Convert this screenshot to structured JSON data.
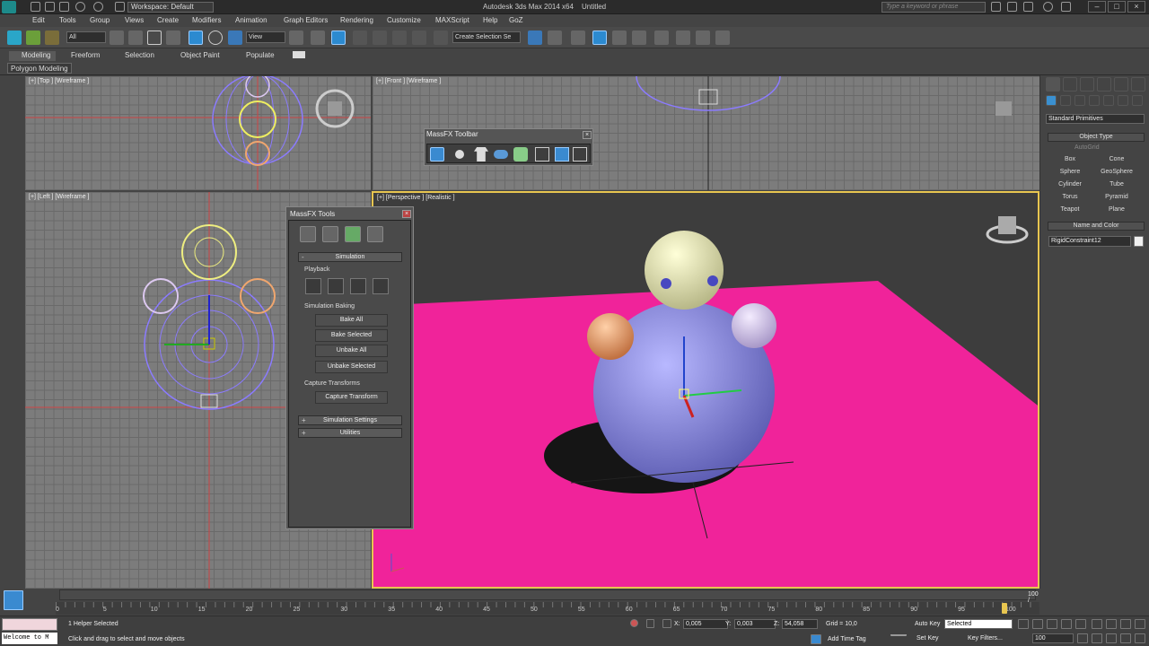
{
  "title_bar": {
    "workspace": "Workspace: Default",
    "app_title": "Autodesk 3ds Max 2014 x64",
    "file_name": "Untitled",
    "search_placeholder": "Type a keyword or phrase"
  },
  "menu": [
    "Edit",
    "Tools",
    "Group",
    "Views",
    "Create",
    "Modifiers",
    "Animation",
    "Graph Editors",
    "Rendering",
    "Customize",
    "MAXScript",
    "Help",
    "GoZ"
  ],
  "toolbar": {
    "selection_filter": "All",
    "ref_coord": "View",
    "named_selection": "Create Selection Se"
  },
  "ribbon": {
    "tabs": [
      "Modeling",
      "Freeform",
      "Selection",
      "Object Paint",
      "Populate"
    ],
    "panel": "Polygon Modeling"
  },
  "viewports": {
    "top": "[+] [Top ] [Wireframe ]",
    "front": "[+] [Front ] [Wireframe ]",
    "left": "[+] [Left ] [Wireframe ]",
    "perspective": "[+] [Perspective ] [Realistic ]"
  },
  "massfx_toolbar": {
    "title": "MassFX Toolbar"
  },
  "massfx_tools": {
    "title": "MassFX Tools",
    "simulation_rollout": "Simulation",
    "playback_label": "Playback",
    "baking_label": "Simulation Baking",
    "bake_all": "Bake All",
    "bake_selected": "Bake Selected",
    "unbake_all": "Unbake All",
    "unbake_selected": "Unbake Selected",
    "capture_label": "Capture Transforms",
    "capture_btn": "Capture Transform",
    "settings_rollout": "Simulation Settings",
    "utilities_rollout": "Utilities"
  },
  "command_panel": {
    "category": "Standard Primitives",
    "object_type": "Object Type",
    "autogrid": "AutoGrid",
    "buttons": [
      "Box",
      "Cone",
      "Sphere",
      "GeoSphere",
      "Cylinder",
      "Tube",
      "Torus",
      "Pyramid",
      "Teapot",
      "Plane"
    ],
    "name_color": "Name and Color",
    "object_name": "RigidConstraint12"
  },
  "timeline": {
    "frame": "100 / 100",
    "ticks": [
      "0",
      "5",
      "10",
      "15",
      "20",
      "25",
      "30",
      "35",
      "40",
      "45",
      "50",
      "55",
      "60",
      "65",
      "70",
      "75",
      "80",
      "85",
      "90",
      "95",
      "100"
    ]
  },
  "status": {
    "maxscript_welcome": "Welcome to M",
    "selection_info": "1 Helper Selected",
    "prompt": "Click and drag to select and move objects",
    "x_label": "X:",
    "x": "0,005",
    "y_label": "Y:",
    "y": "0,003",
    "z_label": "Z:",
    "z": "54,058",
    "grid": "Grid = 10,0",
    "add_time_tag": "Add Time Tag",
    "auto_key": "Auto Key",
    "set_key": "Set Key",
    "key_mode": "Selected",
    "key_filters": "Key Filters...",
    "frame_field": "100"
  },
  "colors": {
    "ground": "#f0239a",
    "body": "#8d8de6",
    "head": "#eeeeb4",
    "arm_left": "#f0a66e",
    "arm_right": "#dcc8f0",
    "active_border": "#e8c650"
  }
}
